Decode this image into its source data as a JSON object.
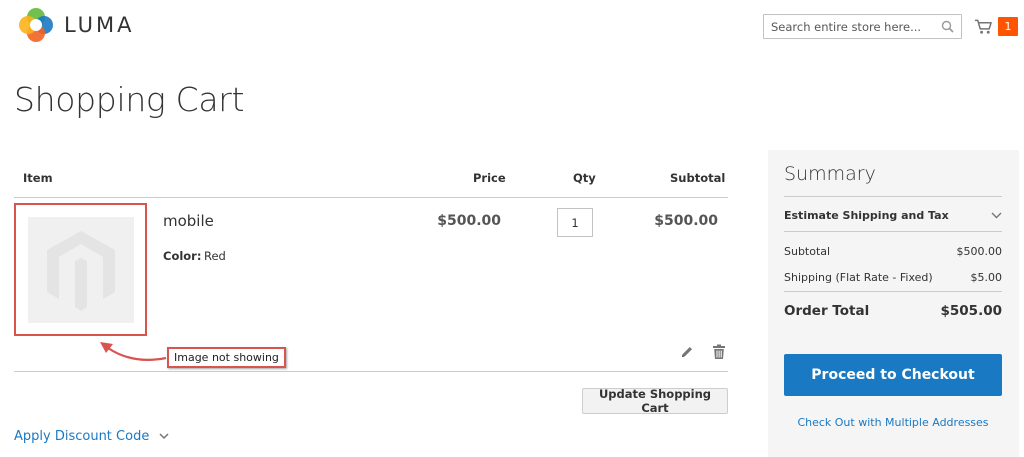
{
  "header": {
    "logo_text": "LUMA",
    "search": {
      "placeholder": "Search entire store here..."
    },
    "cart_count": "1"
  },
  "page_title": "Shopping Cart",
  "cart_table": {
    "columns": {
      "item": "Item",
      "price": "Price",
      "qty": "Qty",
      "subtotal": "Subtotal"
    },
    "items": [
      {
        "name": "mobile",
        "option_label": "Color:",
        "option_value": "Red",
        "price": "$500.00",
        "qty": "1",
        "subtotal": "$500.00"
      }
    ]
  },
  "annotation": {
    "text": "Image not showing",
    "color": "#d9534f"
  },
  "update_button": "Update Shopping Cart",
  "discount_label": "Apply Discount Code",
  "summary": {
    "title": "Summary",
    "estimate_label": "Estimate Shipping and Tax",
    "subtotal_label": "Subtotal",
    "subtotal_value": "$500.00",
    "shipping_label": "Shipping (Flat Rate - Fixed)",
    "shipping_value": "$5.00",
    "order_total_label": "Order Total",
    "order_total_value": "$505.00",
    "checkout_button": "Proceed to Checkout",
    "multi_address_link": "Check Out with Multiple Addresses"
  },
  "colors": {
    "accent_blue": "#1979c3",
    "cart_badge": "#ff5501",
    "annotation_red": "#d9534f",
    "summary_bg": "#f5f5f5"
  },
  "icons": [
    "luma-logo-icon",
    "search-icon",
    "cart-icon",
    "edit-icon",
    "trash-icon",
    "chevron-down-icon",
    "placeholder-image-icon",
    "annotation-arrow-icon"
  ]
}
